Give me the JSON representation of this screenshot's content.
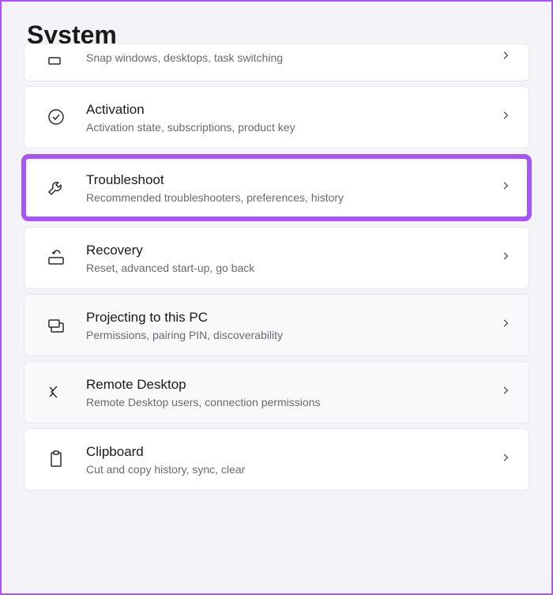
{
  "header": {
    "title": "System"
  },
  "items": [
    {
      "key": "multitasking",
      "title": "",
      "subtitle": "Snap windows, desktops, task switching",
      "icon": "multitask",
      "partial": true,
      "faded": false,
      "highlighted": false
    },
    {
      "key": "activation",
      "title": "Activation",
      "subtitle": "Activation state, subscriptions, product key",
      "icon": "checkmark-circle",
      "partial": false,
      "faded": false,
      "highlighted": false
    },
    {
      "key": "troubleshoot",
      "title": "Troubleshoot",
      "subtitle": "Recommended troubleshooters, preferences, history",
      "icon": "wrench",
      "partial": false,
      "faded": false,
      "highlighted": true
    },
    {
      "key": "recovery",
      "title": "Recovery",
      "subtitle": "Reset, advanced start-up, go back",
      "icon": "recovery",
      "partial": false,
      "faded": false,
      "highlighted": false
    },
    {
      "key": "projecting",
      "title": "Projecting to this PC",
      "subtitle": "Permissions, pairing PIN, discoverability",
      "icon": "project",
      "partial": false,
      "faded": true,
      "highlighted": false
    },
    {
      "key": "remote-desktop",
      "title": "Remote Desktop",
      "subtitle": "Remote Desktop users, connection permissions",
      "icon": "remote",
      "partial": false,
      "faded": true,
      "highlighted": false
    },
    {
      "key": "clipboard",
      "title": "Clipboard",
      "subtitle": "Cut and copy history, sync, clear",
      "icon": "clipboard",
      "partial": false,
      "faded": false,
      "highlighted": false
    }
  ]
}
